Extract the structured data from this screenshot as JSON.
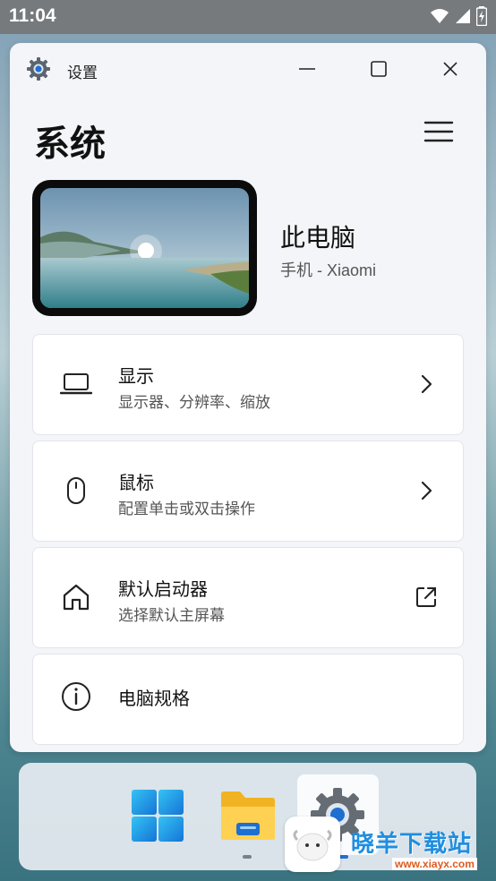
{
  "status_bar": {
    "time": "11:04"
  },
  "window": {
    "title": "设置",
    "page_title": "系统"
  },
  "device": {
    "name": "此电脑",
    "subtitle": "手机 - Xiaomi"
  },
  "cards": [
    {
      "label": "显示",
      "sub": "显示器、分辨率、缩放",
      "icon": "laptop-icon",
      "trail": "chevron-right-icon"
    },
    {
      "label": "鼠标",
      "sub": "配置单击或双击操作",
      "icon": "mouse-icon",
      "trail": "chevron-right-icon"
    },
    {
      "label": "默认启动器",
      "sub": "选择默认主屏幕",
      "icon": "home-icon",
      "trail": "external-link-icon"
    },
    {
      "label": "电脑规格",
      "icon": "info-icon"
    }
  ],
  "taskbar": {
    "items": [
      "start-icon",
      "file-explorer-icon",
      "settings-icon"
    ]
  },
  "watermark": {
    "text": "晓羊下载站",
    "url": "www.xiayx.com"
  },
  "colors": {
    "accent": "#1f6fd1",
    "window_bg": "#f3f5f8",
    "card_bg": "#ffffff"
  }
}
